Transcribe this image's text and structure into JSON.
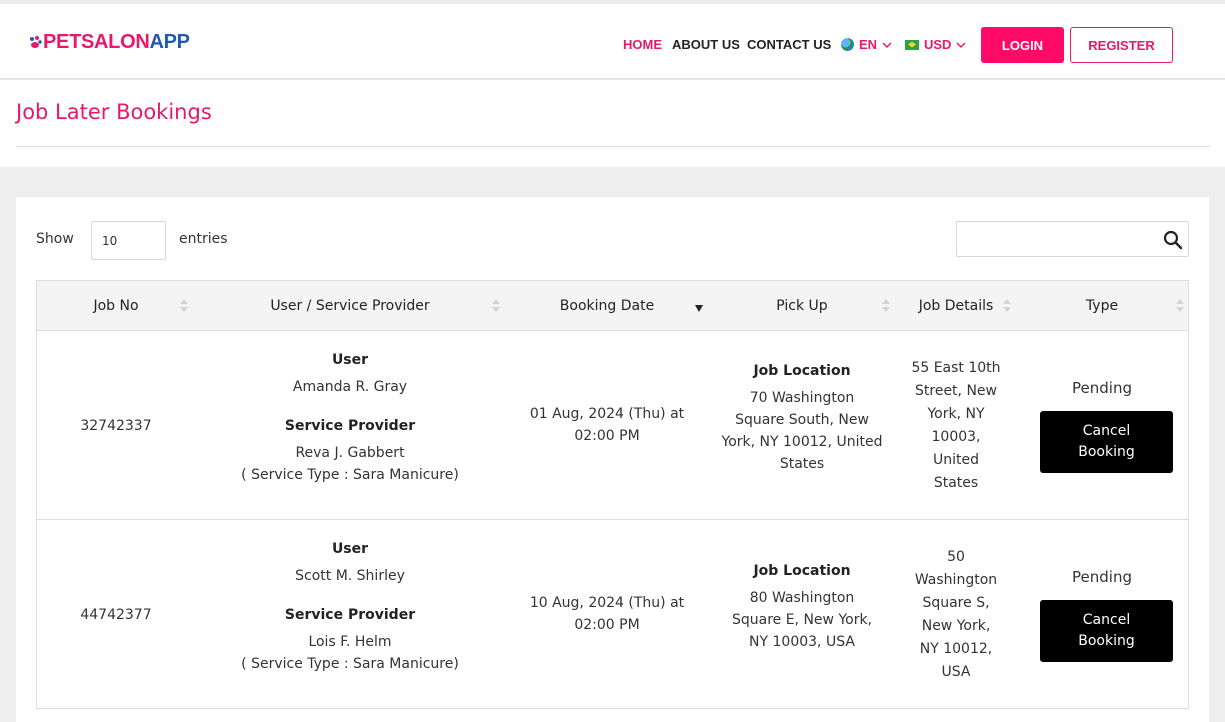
{
  "header": {
    "logo": {
      "part1": "PETSALON",
      "part2": "APP"
    },
    "nav": [
      {
        "label": "HOME",
        "active": true
      },
      {
        "label": "ABOUT US",
        "active": false
      },
      {
        "label": "CONTACT US",
        "active": false
      }
    ],
    "language": "EN",
    "currency": "USD",
    "login_label": "LOGIN",
    "register_label": "REGISTER"
  },
  "page": {
    "title": "Job Later Bookings"
  },
  "table_controls": {
    "show_label": "Show",
    "entries_value": "10",
    "entries_label": "entries",
    "search_value": ""
  },
  "table": {
    "columns": [
      "Job No",
      "User / Service Provider",
      "Booking Date",
      "Pick Up",
      "Job Details",
      "Type"
    ],
    "rows": [
      {
        "job_no": "32742337",
        "user_heading": "User",
        "user_name": "Amanda R. Gray",
        "provider_heading": "Service Provider",
        "provider_name": "Reva J. Gabbert",
        "service_type": "( Service Type : Sara Manicure)",
        "booking_date_line1": "01 Aug, 2024 (Thu) at",
        "booking_date_line2": "02:00 PM",
        "pickup_heading": "Job Location",
        "pickup_lines": [
          "70 Washington",
          "Square South, New",
          "York, NY 10012, United",
          "States"
        ],
        "details_lines": [
          "55 East 10th",
          "Street, New",
          "York, NY",
          "10003,",
          "United",
          "States"
        ],
        "status": "Pending",
        "cancel_line1": "Cancel",
        "cancel_line2": "Booking"
      },
      {
        "job_no": "44742377",
        "user_heading": "User",
        "user_name": "Scott M. Shirley",
        "provider_heading": "Service Provider",
        "provider_name": "Lois F. Helm",
        "service_type": "( Service Type : Sara Manicure)",
        "booking_date_line1": "10 Aug, 2024 (Thu) at",
        "booking_date_line2": "02:00 PM",
        "pickup_heading": "Job Location",
        "pickup_lines": [
          "80 Washington",
          "Square E, New York,",
          "NY 10003, USA"
        ],
        "details_lines": [
          "50",
          "Washington",
          "Square S,",
          "New York,",
          "NY 10012,",
          "USA"
        ],
        "status": "Pending",
        "cancel_line1": "Cancel",
        "cancel_line2": "Booking"
      }
    ]
  },
  "colors": {
    "brand_pink": "#e8196b",
    "brand_blue": "#1f58b5",
    "button_black": "#000000"
  }
}
